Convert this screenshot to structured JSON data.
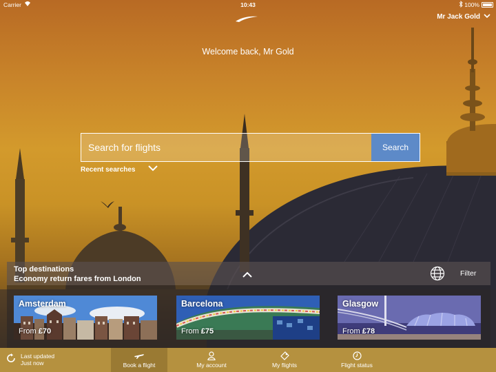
{
  "status_bar": {
    "carrier": "Carrier",
    "time": "10:43",
    "battery": "100%"
  },
  "header": {
    "user_menu_label": "Mr Jack Gold",
    "welcome": "Welcome back, Mr Gold"
  },
  "search": {
    "placeholder": "Search for flights",
    "button_label": "Search",
    "recent_label": "Recent searches"
  },
  "destinations": {
    "title": "Top destinations",
    "subtitle": "Economy return fares from London",
    "filter_label": "Filter",
    "cards": [
      {
        "city": "Amsterdam",
        "from": "From",
        "price": "£70"
      },
      {
        "city": "Barcelona",
        "from": "From",
        "price": "£75"
      },
      {
        "city": "Glasgow",
        "from": "From",
        "price": "£78"
      }
    ]
  },
  "bottom_bar": {
    "last_updated_line1": "Last updated",
    "last_updated_line2": "Just now",
    "tabs": [
      {
        "label": "Book a flight",
        "icon": "plane-icon"
      },
      {
        "label": "My account",
        "icon": "person-icon"
      },
      {
        "label": "My flights",
        "icon": "ticket-icon"
      },
      {
        "label": "Flight status",
        "icon": "clock-icon"
      }
    ]
  },
  "colors": {
    "search_button": "#5d8ac8",
    "bottom_bar": "#b5913f",
    "bottom_bar_active": "#9a7a33"
  }
}
